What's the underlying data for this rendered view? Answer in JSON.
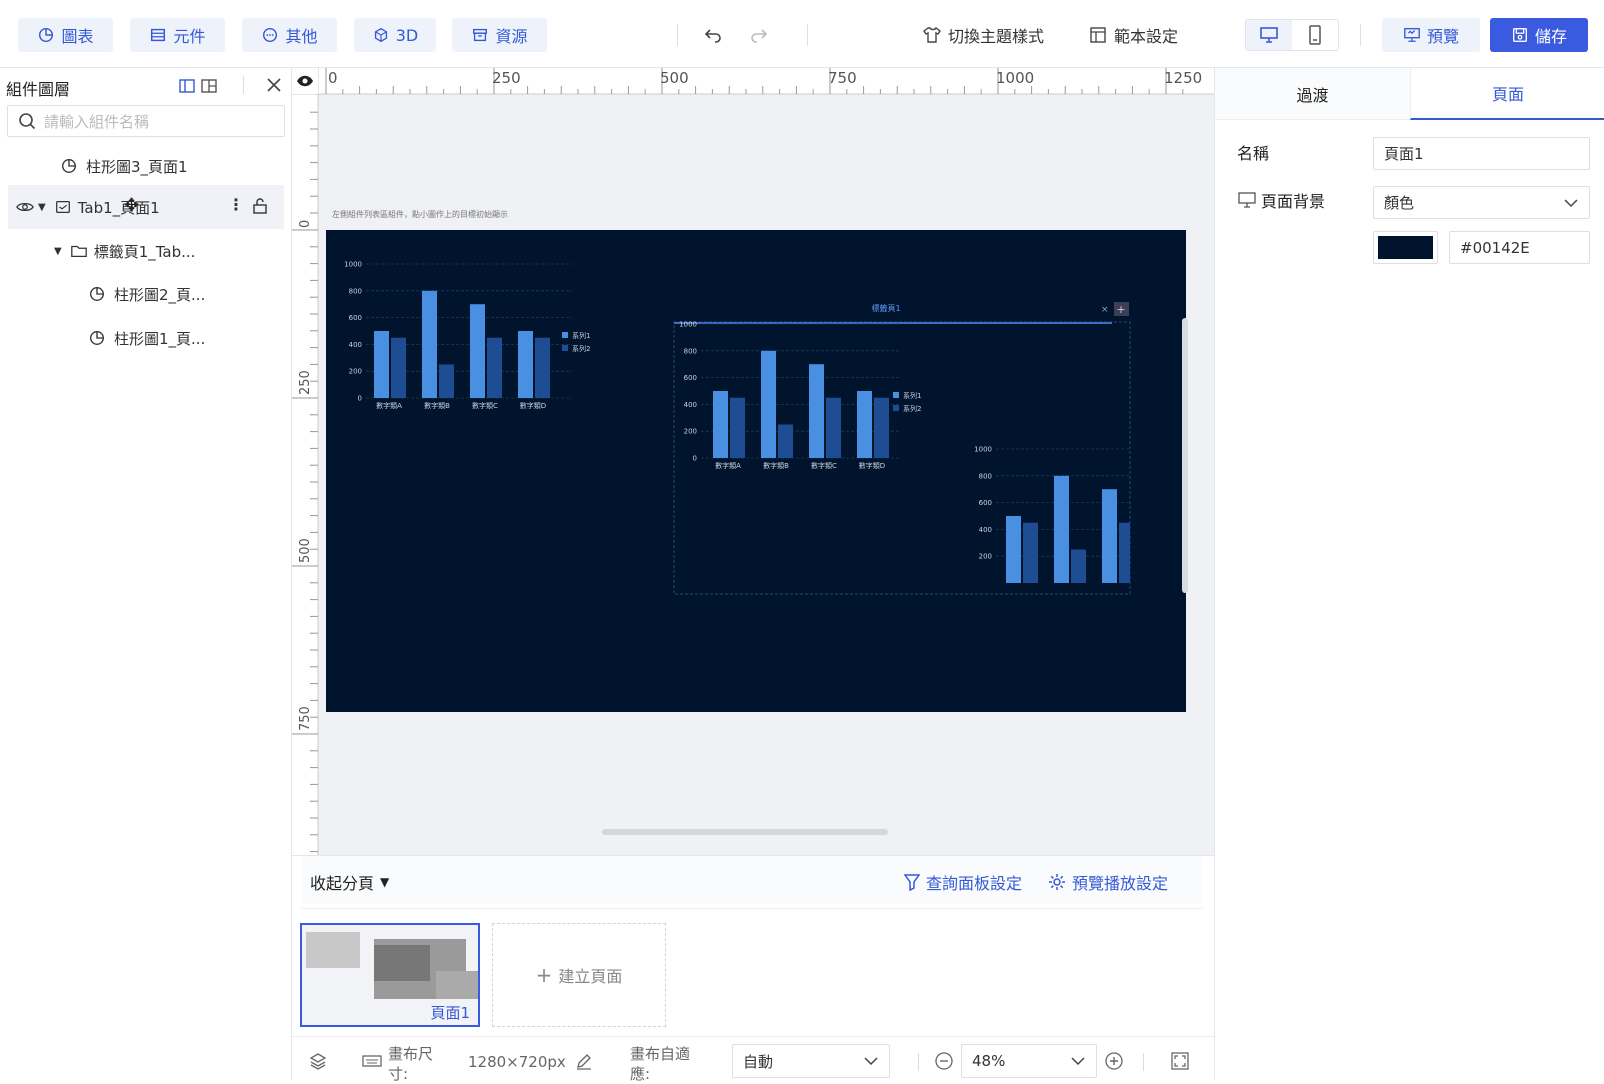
{
  "toolbar": {
    "tabs": [
      {
        "label": "圖表",
        "icon": "chart-pie-icon"
      },
      {
        "label": "元件",
        "icon": "table-icon"
      },
      {
        "label": "其他",
        "icon": "dots-circle-icon"
      },
      {
        "label": "3D",
        "icon": "cube-icon"
      },
      {
        "label": "資源",
        "icon": "archive-icon"
      }
    ],
    "theme_label": "切換主題樣式",
    "template_label": "範本設定",
    "preview_label": "預覽",
    "save_label": "儲存"
  },
  "layers": {
    "title": "組件圖層",
    "search_placeholder": "請輸入組件名稱",
    "items": [
      {
        "label": "柱形圖3_頁面1"
      },
      {
        "label": "Tab1_頁面1"
      },
      {
        "label": "標籤頁1_Tab..."
      },
      {
        "label": "柱形圖2_頁..."
      },
      {
        "label": "柱形圖1_頁..."
      }
    ]
  },
  "ruler": {
    "h_labels": [
      "0",
      "250",
      "500",
      "750",
      "1000",
      "1250"
    ],
    "v_labels": [
      "0",
      "250",
      "500",
      "750"
    ]
  },
  "canvas": {
    "bg_color": "#00142E",
    "hint_text": "左側組件列表區組件，點小圖作上的目標初始顯示",
    "tab_title": "標籤頁1"
  },
  "charts": [
    {
      "type": "bar",
      "categories": [
        "數字類A",
        "數字類B",
        "數字類C",
        "數字類D"
      ],
      "ylim": [
        0,
        1000
      ],
      "yticks": [
        "1000",
        "800",
        "600",
        "400",
        "200",
        "0"
      ],
      "series": [
        {
          "name": "系列1",
          "values": [
            500,
            800,
            700,
            500
          ],
          "color": "#4a90e2"
        },
        {
          "name": "系列2",
          "values": [
            450,
            250,
            450,
            450
          ],
          "color": "#1e4d94"
        }
      ]
    },
    {
      "type": "bar",
      "categories": [
        "數字類A",
        "數字類B",
        "數字類C",
        "數字類D"
      ],
      "ylim": [
        0,
        1000
      ],
      "yticks": [
        "1000",
        "800",
        "600",
        "400",
        "200",
        "0"
      ],
      "series": [
        {
          "name": "系列1",
          "values": [
            500,
            800,
            700,
            500
          ],
          "color": "#4a90e2"
        },
        {
          "name": "系列2",
          "values": [
            450,
            250,
            450,
            450
          ],
          "color": "#1e4d94"
        }
      ]
    },
    {
      "type": "bar",
      "categories": [],
      "ylim": [
        0,
        1000
      ],
      "yticks": [
        "1000",
        "800",
        "600",
        "400",
        "200"
      ],
      "series": [
        {
          "name": "系列1",
          "values": [
            500,
            800,
            700
          ],
          "color": "#4a90e2"
        },
        {
          "name": "系列2",
          "values": [
            450,
            250,
            450
          ],
          "color": "#1e4d94"
        }
      ]
    }
  ],
  "right": {
    "tabs": [
      "過渡",
      "頁面"
    ],
    "name_label": "名稱",
    "name_value": "頁面1",
    "bg_label": "頁面背景",
    "bg_type": "顏色",
    "bg_color": "#00142E"
  },
  "pages": {
    "collapse_label": "收起分頁",
    "query_label": "查詢面板設定",
    "playback_label": "預覽播放設定",
    "page_label": "頁面1",
    "create_label": "建立頁面"
  },
  "status": {
    "canvas_size_label": "畫布尺寸:",
    "canvas_size_value": "1280×720px",
    "fit_label": "畫布自適應:",
    "fit_value": "自動",
    "zoom_value": "48%"
  }
}
